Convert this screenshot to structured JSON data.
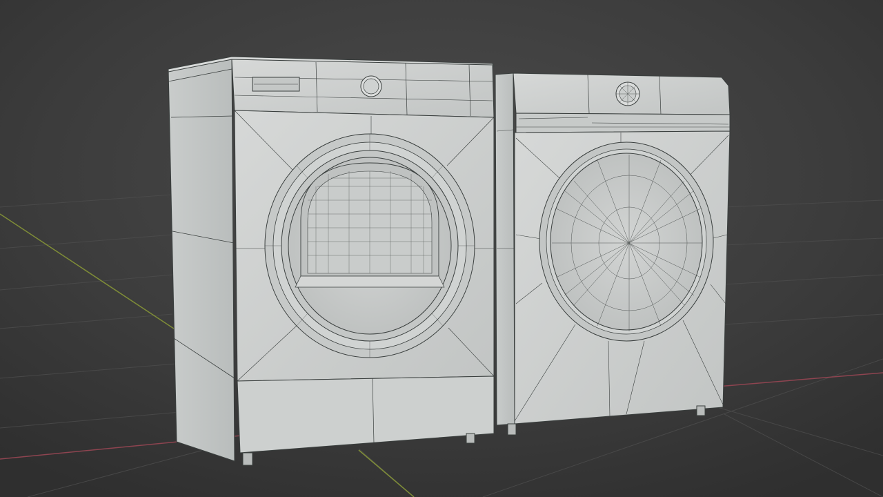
{
  "viewport": {
    "background_color": "#3e3e3e",
    "grid_color": "#4b4b4b",
    "x_axis_color": "#9a4550",
    "y_axis_color": "#8a9a3a",
    "mesh_color": "#cdd0cf",
    "wire_color": "#3a3f3e"
  },
  "scene": {
    "objects": [
      "dryer",
      "washing-machine"
    ],
    "render_mode": "wireframe-on-shaded"
  }
}
